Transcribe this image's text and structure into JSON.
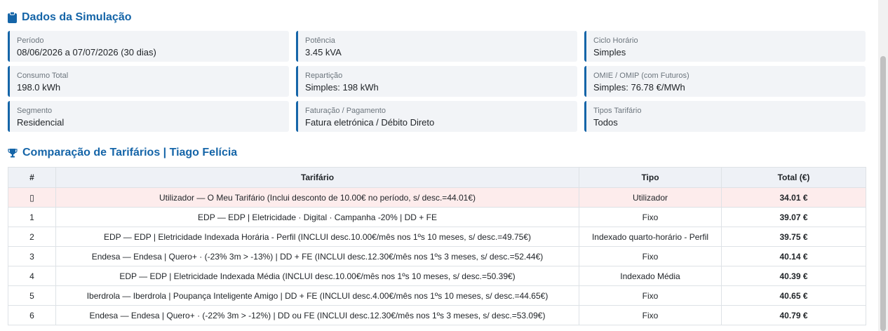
{
  "sim": {
    "title": "Dados da Simulação",
    "fields": [
      {
        "label": "Período",
        "value": "08/06/2026 a 07/07/2026 (30 dias)"
      },
      {
        "label": "Potência",
        "value": "3.45 kVA"
      },
      {
        "label": "Ciclo Horário",
        "value": "Simples"
      },
      {
        "label": "Consumo Total",
        "value": "198.0 kWh"
      },
      {
        "label": "Repartição",
        "value": "Simples: 198 kWh"
      },
      {
        "label": "OMIE / OMIP (com Futuros)",
        "value": "Simples: 76.78 €/MWh"
      },
      {
        "label": "Segmento",
        "value": "Residencial"
      },
      {
        "label": "Faturação / Pagamento",
        "value": "Fatura eletrónica / Débito Direto"
      },
      {
        "label": "Tipos Tarifário",
        "value": "Todos"
      }
    ]
  },
  "comparison": {
    "title": "Comparação de Tarifários | Tiago Felícia",
    "headers": [
      "#",
      "Tarifário",
      "Tipo",
      "Total (€)"
    ],
    "rows": [
      {
        "rank": "▯",
        "tariff": "Utilizador — O Meu Tarifário (Inclui desconto de 10.00€ no período, s/ desc.=44.01€)",
        "type": "Utilizador",
        "total": "34.01 €"
      },
      {
        "rank": "1",
        "tariff": "EDP — EDP | Eletricidade · Digital · Campanha -20% | DD + FE",
        "type": "Fixo",
        "total": "39.07 €"
      },
      {
        "rank": "2",
        "tariff": "EDP — EDP | Eletricidade Indexada Horária - Perfil (INCLUI desc.10.00€/mês nos 1ºs 10 meses, s/ desc.=49.75€)",
        "type": "Indexado quarto-horário - Perfil",
        "total": "39.75 €"
      },
      {
        "rank": "3",
        "tariff": "Endesa — Endesa | Quero+ · (-23% 3m > -13%) | DD + FE (INCLUI desc.12.30€/mês nos 1ºs 3 meses, s/ desc.=52.44€)",
        "type": "Fixo",
        "total": "40.14 €"
      },
      {
        "rank": "4",
        "tariff": "EDP — EDP | Eletricidade Indexada Média (INCLUI desc.10.00€/mês nos 1ºs 10 meses, s/ desc.=50.39€)",
        "type": "Indexado Média",
        "total": "40.39 €"
      },
      {
        "rank": "5",
        "tariff": "Iberdrola — Iberdrola | Poupança Inteligente Amigo | DD + FE (INCLUI desc.4.00€/mês nos 1ºs 10 meses, s/ desc.=44.65€)",
        "type": "Fixo",
        "total": "40.65 €"
      },
      {
        "rank": "6",
        "tariff": "Endesa — Endesa | Quero+ · (-22% 3m > -12%) | DD ou FE (INCLUI desc.12.30€/mês nos 1ºs 3 meses, s/ desc.=53.09€)",
        "type": "Fixo",
        "total": "40.79 €"
      }
    ]
  },
  "colors": {
    "accent": "#1565a8",
    "highlight_row": "#fdecec",
    "card_bg": "#f2f4f7"
  },
  "icons": {
    "sim": "clipboard-icon",
    "comparison": "trophy-icon"
  }
}
